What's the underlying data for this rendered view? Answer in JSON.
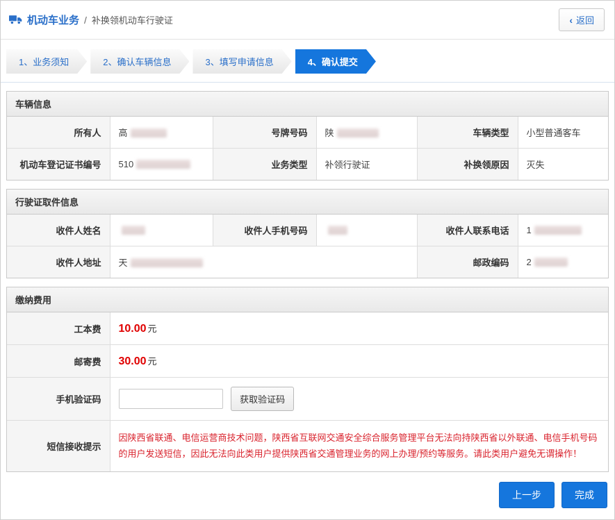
{
  "header": {
    "title": "机动车业务",
    "separator": "/",
    "subtitle": "补换领机动车行驶证",
    "back_button": "返回",
    "back_chevron": "‹"
  },
  "steps": {
    "items": [
      {
        "label": "1、业务须知"
      },
      {
        "label": "2、确认车辆信息"
      },
      {
        "label": "3、填写申请信息"
      },
      {
        "label": "4、确认提交"
      }
    ],
    "active_index": 3
  },
  "vehicle_info": {
    "title": "车辆信息",
    "fields": {
      "owner": {
        "label": "所有人",
        "value": "高",
        "redacted": true
      },
      "plate": {
        "label": "号牌号码",
        "value": "陕",
        "redacted": true
      },
      "vehicle_type": {
        "label": "车辆类型",
        "value": "小型普通客车",
        "redacted": false
      },
      "reg_cert_no": {
        "label": "机动车登记证书编号",
        "value": "510",
        "redacted": true
      },
      "business_type": {
        "label": "业务类型",
        "value": "补领行驶证",
        "redacted": false
      },
      "reason": {
        "label": "补换领原因",
        "value": "灭失",
        "redacted": false
      }
    }
  },
  "pickup_info": {
    "title": "行驶证取件信息",
    "fields": {
      "recipient_name": {
        "label": "收件人姓名",
        "value": "",
        "redacted": true
      },
      "recipient_mobile": {
        "label": "收件人手机号码",
        "value": "",
        "redacted": true
      },
      "recipient_phone": {
        "label": "收件人联系电话",
        "value": "1",
        "redacted": true
      },
      "recipient_address": {
        "label": "收件人地址",
        "value": "天",
        "redacted": true
      },
      "postal_code": {
        "label": "邮政编码",
        "value": "2",
        "redacted": true
      }
    }
  },
  "fees": {
    "title": "缴纳费用",
    "production_fee": {
      "label": "工本费",
      "amount": "10.00",
      "unit": "元"
    },
    "postage_fee": {
      "label": "邮寄费",
      "amount": "30.00",
      "unit": "元"
    },
    "sms_code": {
      "label": "手机验证码",
      "input_value": "",
      "button": "获取验证码"
    },
    "sms_notice": {
      "label": "短信接收提示",
      "text": "因陕西省联通、电信运营商技术问题，陕西省互联网交通安全综合服务管理平台无法向持陕西省以外联通、电信手机号码的用户发送短信，因此无法向此类用户提供陕西省交通管理业务的网上办理/预约等服务。请此类用户避免无谓操作！"
    }
  },
  "footer": {
    "prev_button": "上一步",
    "finish_button": "完成"
  },
  "colors": {
    "accent_blue": "#2a6fc9",
    "active_step_blue": "#1576dd",
    "fee_red": "#e00000",
    "notice_red": "#d9232d"
  }
}
